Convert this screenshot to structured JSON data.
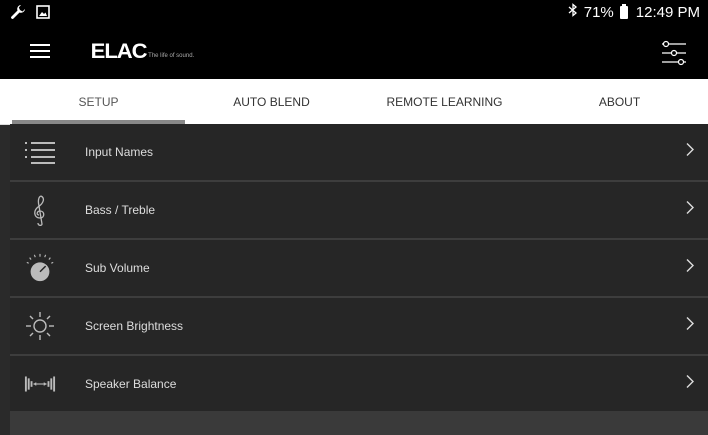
{
  "status_bar": {
    "icons_left": [
      "wrench-icon",
      "image-icon"
    ],
    "bluetooth_icon": "bluetooth-icon",
    "battery_icon": "battery-icon",
    "battery_percent": "71%",
    "time": "12:49 PM"
  },
  "app_bar": {
    "menu_icon": "hamburger-menu-icon",
    "logo_text": "ELAC",
    "logo_tagline": "The life of sound.",
    "filter_icon": "sliders-icon"
  },
  "tabs": [
    {
      "label": "SETUP",
      "active": true
    },
    {
      "label": "AUTO BLEND",
      "active": false
    },
    {
      "label": "REMOTE LEARNING",
      "active": false
    },
    {
      "label": "ABOUT",
      "active": false
    }
  ],
  "settings": [
    {
      "label": "Input Names",
      "icon": "list-icon"
    },
    {
      "label": "Bass / Treble",
      "icon": "treble-clef-icon"
    },
    {
      "label": "Sub Volume",
      "icon": "volume-knob-icon"
    },
    {
      "label": "Screen Brightness",
      "icon": "brightness-icon"
    },
    {
      "label": "Speaker Balance",
      "icon": "speaker-balance-icon"
    }
  ],
  "colors": {
    "bar_background": "#000000",
    "tab_background": "#ffffff",
    "row_background": "#262626",
    "indicator": "#888888"
  }
}
